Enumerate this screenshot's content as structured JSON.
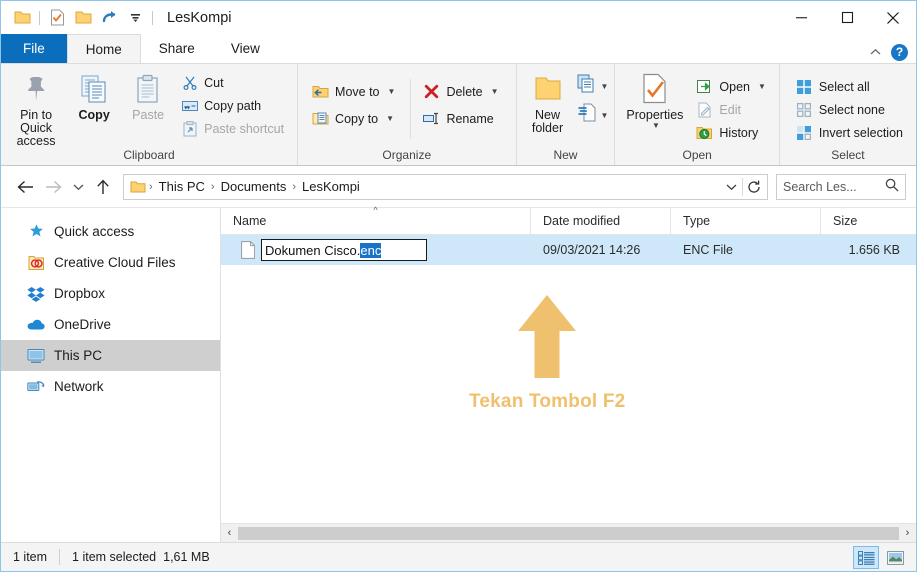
{
  "window": {
    "title": "LesKompi",
    "quick_access_icons": [
      "folder-icon",
      "properties-icon",
      "new-folder-icon",
      "undo-icon",
      "customize-qat-chevron-icon"
    ],
    "caption": {
      "minimize": "minimize-icon",
      "maximize": "maximize-icon",
      "close": "close-icon"
    }
  },
  "ribbon": {
    "tabs": [
      {
        "label": "File",
        "active": false,
        "style": "file"
      },
      {
        "label": "Home",
        "active": true
      },
      {
        "label": "Share",
        "active": false
      },
      {
        "label": "View",
        "active": false
      }
    ],
    "collapse_label": "collapse-ribbon-icon",
    "help_label": "?",
    "groups": [
      {
        "name": "Clipboard",
        "label": "Clipboard",
        "big": [
          {
            "label": "Pin to Quick\naccess",
            "icon": "pin-icon",
            "disabled": false
          },
          {
            "label": "Copy",
            "icon": "copy-icon",
            "disabled": false
          },
          {
            "label": "Paste",
            "icon": "paste-icon",
            "disabled": true
          }
        ],
        "small": [
          {
            "label": "Cut",
            "icon": "scissors-icon",
            "disabled": false
          },
          {
            "label": "Copy path",
            "icon": "copy-path-icon",
            "disabled": false
          },
          {
            "label": "Paste shortcut",
            "icon": "paste-shortcut-icon",
            "disabled": true
          }
        ]
      },
      {
        "name": "Organize",
        "label": "Organize",
        "small_a": [
          {
            "label": "Move to",
            "icon": "move-to-icon",
            "caret": true
          },
          {
            "label": "Copy to",
            "icon": "copy-to-icon",
            "caret": true
          }
        ],
        "small_b": [
          {
            "label": "Delete",
            "icon": "delete-icon",
            "caret": true
          },
          {
            "label": "Rename",
            "icon": "rename-icon",
            "caret": false
          }
        ]
      },
      {
        "name": "New",
        "label": "New",
        "big": [
          {
            "label": "New\nfolder",
            "icon": "new-folder-icon"
          }
        ],
        "tiny": [
          {
            "icon": "new-item-icon",
            "caret": true
          },
          {
            "icon": "easy-access-icon",
            "caret": true
          }
        ]
      },
      {
        "name": "Open",
        "label": "Open",
        "big": [
          {
            "label": "Properties",
            "icon": "properties-icon",
            "caret": true
          }
        ],
        "small": [
          {
            "label": "Open",
            "icon": "open-icon",
            "caret": true,
            "disabled": false
          },
          {
            "label": "Edit",
            "icon": "edit-icon",
            "caret": false,
            "disabled": true
          },
          {
            "label": "History",
            "icon": "history-icon",
            "caret": false,
            "disabled": false
          }
        ]
      },
      {
        "name": "Select",
        "label": "Select",
        "small": [
          {
            "label": "Select all",
            "icon": "select-all-icon"
          },
          {
            "label": "Select none",
            "icon": "select-none-icon"
          },
          {
            "label": "Invert selection",
            "icon": "invert-selection-icon"
          }
        ]
      }
    ]
  },
  "addressbar": {
    "back": "back-arrow-icon",
    "forward": "forward-arrow-icon",
    "recent": "recent-locations-chevron-icon",
    "up": "up-arrow-icon",
    "folder_icon": "folder-icon",
    "breadcrumbs": [
      "This PC",
      "Documents",
      "LesKompi"
    ],
    "separator": "›",
    "dropdown": "address-dropdown-chevron-icon",
    "refresh": "refresh-icon",
    "search_placeholder": "Search Les...",
    "search_icon": "search-icon"
  },
  "navpane": {
    "items": [
      {
        "label": "Quick access",
        "icon": "star-icon",
        "selected": false
      },
      {
        "label": "Creative Cloud Files",
        "icon": "creative-cloud-icon",
        "selected": false
      },
      {
        "label": "Dropbox",
        "icon": "dropbox-icon",
        "selected": false
      },
      {
        "label": "OneDrive",
        "icon": "onedrive-cloud-icon",
        "selected": false
      },
      {
        "label": "This PC",
        "icon": "this-pc-icon",
        "selected": true
      },
      {
        "label": "Network",
        "icon": "network-icon",
        "selected": false
      }
    ]
  },
  "filelist": {
    "columns": [
      {
        "label": "Name",
        "sorted": true,
        "sort_caret": "^"
      },
      {
        "label": "Date modified",
        "sorted": false
      },
      {
        "label": "Type",
        "sorted": false
      },
      {
        "label": "Size",
        "sorted": false
      }
    ],
    "rows": [
      {
        "icon": "generic-file-icon",
        "name_base": "Dokumen Cisco.",
        "name_selected": "enc",
        "date_modified": "09/03/2021 14:26",
        "type": "ENC File",
        "size": "1.656 KB",
        "renaming": true,
        "selected": true
      }
    ]
  },
  "annotation": {
    "arrow_icon": "up-arrow-annotation",
    "text": "Tekan Tombol F2",
    "color": "#efc06e"
  },
  "scrollbar": {
    "left_arrow": "‹",
    "right_arrow": "›"
  },
  "statusbar": {
    "item_count": "1 item",
    "selection": "1 item selected",
    "selection_size": "1,61 MB",
    "views": [
      {
        "name": "details-view-button",
        "active": true
      },
      {
        "name": "large-icons-view-button",
        "active": false
      }
    ]
  },
  "colors": {
    "accent": "#0b6ebd",
    "selection_row": "#cfe8f9",
    "text_selection": "#1673c8",
    "annotation": "#efc06e",
    "nav_selected": "#cfcfcf"
  }
}
